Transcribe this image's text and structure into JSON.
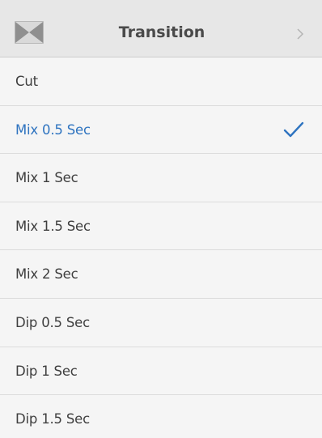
{
  "header": {
    "title": "Transition",
    "left_icon": "transition-wipe-icon",
    "right_icon": "chevron-right-icon"
  },
  "items": [
    {
      "label": "Cut",
      "selected": false
    },
    {
      "label": "Mix 0.5 Sec",
      "selected": true
    },
    {
      "label": "Mix 1 Sec",
      "selected": false
    },
    {
      "label": "Mix 1.5 Sec",
      "selected": false
    },
    {
      "label": "Mix 2 Sec",
      "selected": false
    },
    {
      "label": "Dip 0.5 Sec",
      "selected": false
    },
    {
      "label": "Dip 1 Sec",
      "selected": false
    },
    {
      "label": "Dip 1.5 Sec",
      "selected": false
    }
  ],
  "selected_indicator_icon": "checkmark-icon",
  "colors": {
    "accent": "#2f74c0",
    "header_bg": "#e7e7e7",
    "list_bg": "#f5f5f5",
    "text": "#3f3f3f"
  }
}
